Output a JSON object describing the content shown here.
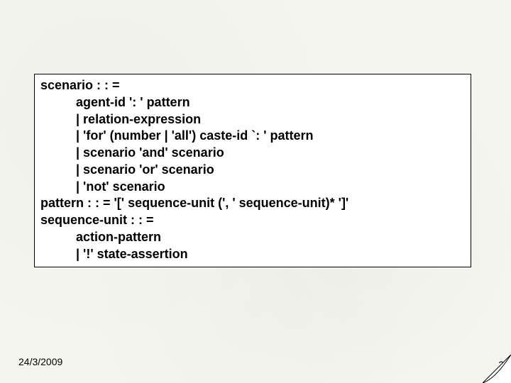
{
  "grammar": {
    "lines": [
      "scenario : : =",
      "          agent-id ': ' pattern",
      "          | relation-expression",
      "          | 'for' (number | 'all') caste-id `: ' pattern",
      "          | scenario 'and' scenario",
      "          | scenario 'or' scenario",
      "          | 'not' scenario",
      "pattern : : = '[' sequence-unit (', ' sequence-unit)* ']'",
      "sequence-unit : : =",
      "          action-pattern",
      "          | '!' state-assertion"
    ]
  },
  "footer": {
    "date": "24/3/2009",
    "page_number": "33"
  }
}
